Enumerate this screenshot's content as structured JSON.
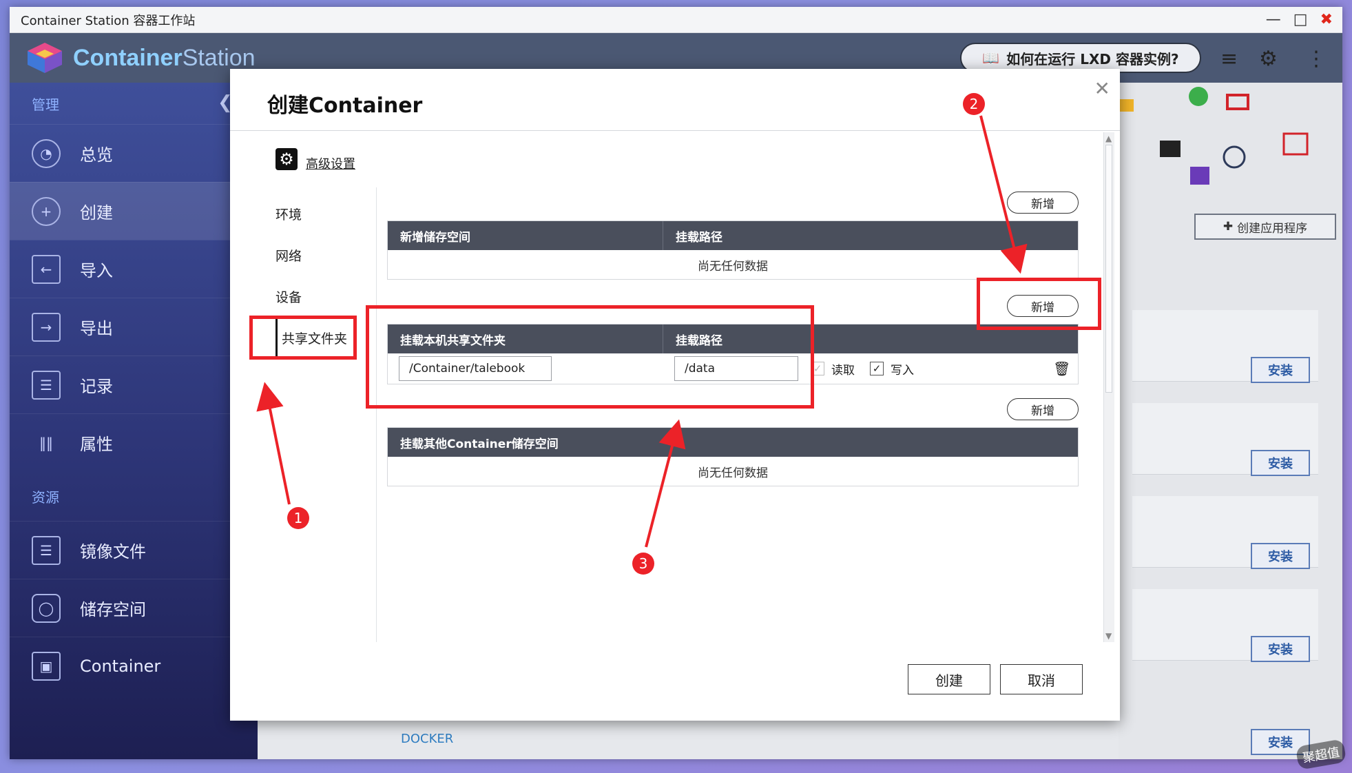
{
  "window": {
    "title": "Container Station 容器工作站"
  },
  "header": {
    "logo_text_a": "Container",
    "logo_text_b": "Station",
    "help_text": "如何在运行 LXD 容器实例?"
  },
  "sidebar": {
    "section_manage": "管理",
    "section_resources": "资源",
    "items": [
      {
        "label": "总览"
      },
      {
        "label": "创建"
      },
      {
        "label": "导入"
      },
      {
        "label": "导出"
      },
      {
        "label": "记录"
      },
      {
        "label": "属性"
      }
    ],
    "resource_items": [
      {
        "label": "镜像文件"
      },
      {
        "label": "储存空间"
      },
      {
        "label": "Container"
      }
    ]
  },
  "right": {
    "create_app": "创建应用程序",
    "install_label": "安装",
    "docker": "DOCKER"
  },
  "modal": {
    "title": "创建Container",
    "advanced": "高级设置",
    "tabs": [
      "环境",
      "网络",
      "设备",
      "共享文件夹"
    ],
    "add_label": "新增",
    "no_data": "尚无任何数据",
    "table1": {
      "col1": "新增储存空间",
      "col2": "挂载路径"
    },
    "table2": {
      "col1": "挂载本机共享文件夹",
      "col2": "挂载路径",
      "row": {
        "host_path": "/Container/talebook",
        "mount_path": "/data",
        "read": "读取",
        "write": "写入"
      }
    },
    "table3": {
      "col1": "挂载其他Container储存空间"
    },
    "create_button": "创建",
    "cancel_button": "取消"
  },
  "annotations": {
    "n1": "1",
    "n2": "2",
    "n3": "3"
  },
  "watermark": "聚超值"
}
